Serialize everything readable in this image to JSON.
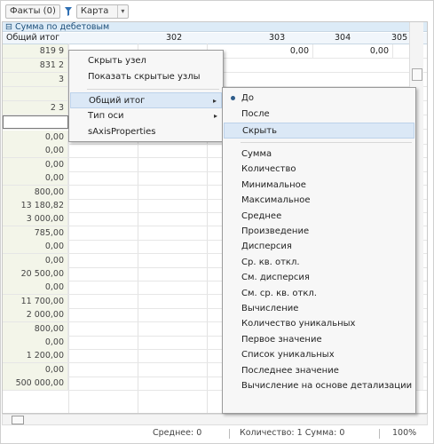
{
  "toolbar": {
    "facts_label": "Факты (0)",
    "card_label": "Карта",
    "card_arrow": "▾"
  },
  "grid": {
    "group_header": "⊟ Сумма по дебетовым",
    "header_row": [
      "Общий итог",
      "302",
      "303",
      "304",
      "305"
    ],
    "visible_row_values": [
      "819 9",
      "831 2",
      "3",
      "",
      "2 3"
    ],
    "top_right_values": [
      "0,00",
      "0,00"
    ],
    "values": [
      "0,00",
      "0,00",
      "0,00",
      "0,00",
      "800,00",
      "13 180,82",
      "3 000,00",
      "785,00",
      "0,00",
      "0,00",
      "20 500,00",
      "0,00",
      "11 700,00",
      "2 000,00",
      "800,00",
      "0,00",
      "1 200,00",
      "0,00",
      "500 000,00"
    ]
  },
  "menu_primary": {
    "items": [
      "Скрыть узел",
      "Показать скрытые узлы",
      "Общий итог",
      "Тип оси",
      "sAxisProperties"
    ],
    "submenu_arrow": "▸"
  },
  "menu_total": {
    "items": [
      "До",
      "После",
      "Скрыть",
      "Сумма",
      "Количество",
      "Минимальное",
      "Максимальное",
      "Среднее",
      "Произведение",
      "Дисперсия",
      "Ср. кв. откл.",
      "См. дисперсия",
      "См. ср. кв. откл.",
      "Вычисление",
      "Количество уникальных",
      "Первое значение",
      "Список уникальных",
      "Последнее значение",
      "Вычисление на основе детализации"
    ],
    "selected": "До",
    "highlighted": "Скрыть"
  },
  "status": {
    "average": "Среднее: 0",
    "count_sum": "Количество: 1  Сумма: 0",
    "zoom": "100%"
  }
}
